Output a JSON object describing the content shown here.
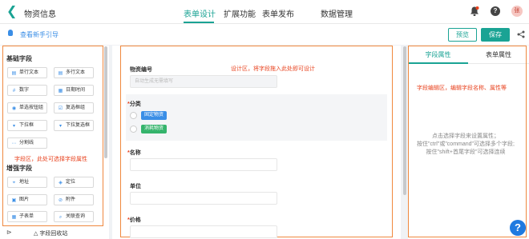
{
  "header": {
    "back_icon": "chevron-left-icon",
    "title": "物资信息",
    "tabs": [
      {
        "label": "表单设计",
        "active": true
      },
      {
        "label": "扩展功能",
        "active": false
      },
      {
        "label": "表单发布",
        "active": false
      },
      {
        "label": "数据管理",
        "active": false
      }
    ],
    "help_label": "?",
    "avatar_label": "张",
    "accent_color": "#1aa394"
  },
  "toolbar": {
    "guide_label": "查看新手引导",
    "preview_label": "预览",
    "save_label": "保存"
  },
  "field_panel": {
    "basic_title": "基础字段",
    "basic_fields": [
      "单行文本",
      "多行文本",
      "数字",
      "日期时间",
      "单选按钮组",
      "复选框组",
      "下拉框",
      "下拉复选框",
      "分割线"
    ],
    "advanced_title": "增强字段",
    "advanced_fields": [
      "地址",
      "定位",
      "图片",
      "附件",
      "子表单",
      "关联查询"
    ],
    "note": "字段区，此处可选择字段属性",
    "recycle_label": "字段回收站"
  },
  "design_area": {
    "note": "设计区，将字段拖入此处即可设计",
    "fields": {
      "code_label": "物资编号",
      "code_placeholder": "自动生成无需填写",
      "category_label": "分类",
      "category_options": [
        "固定物资",
        "消耗物资"
      ],
      "name_label": "名称",
      "unit_label": "单位",
      "price_label": "价格"
    }
  },
  "property_panel": {
    "tabs": [
      {
        "label": "字段属性",
        "active": true
      },
      {
        "label": "表单属性",
        "active": false
      }
    ],
    "note": "字段编辑区，编辑字段名称、属性等",
    "hint_lines": [
      "点击选择字段来设置属性；",
      "按住\"ctrl\"或\"command\"可选择多个字段;",
      "按住\"shift+首尾字段\"可选择连续"
    ]
  },
  "fab_label": "?"
}
